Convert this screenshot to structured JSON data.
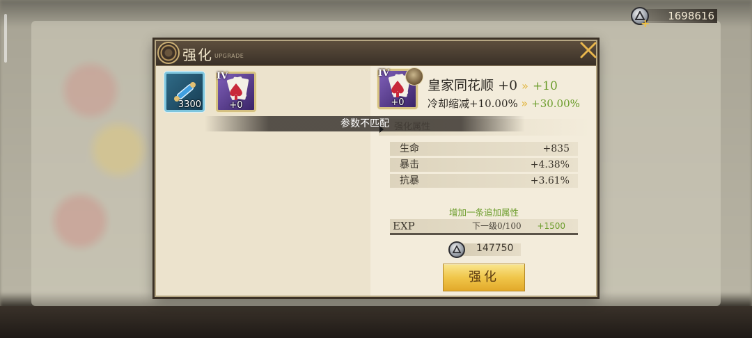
{
  "currency": {
    "value": "1698616",
    "icon": "silver-coin-icon"
  },
  "dialog": {
    "title": "强化",
    "subtitle": "UPGRADE"
  },
  "materials": [
    {
      "name": "scroll",
      "icon": "scroll-icon",
      "count": "3300"
    },
    {
      "name": "royal-flush-card",
      "icon": "spade-card-icon",
      "level": "IV",
      "plus": "+0"
    }
  ],
  "target": {
    "icon": "spade-card-icon",
    "level": "IV",
    "plus": "+0",
    "name": "皇家同花顺",
    "current_level": "+0",
    "next_level": "+10",
    "cooldown_label": "冷却缩减+10.00%",
    "cooldown_next": "+30.00%"
  },
  "banner": "参数不匹配",
  "attributes": {
    "heading": "强化属性",
    "rows": [
      {
        "key": "生命",
        "value": "+835"
      },
      {
        "key": "暴击",
        "value": "+4.38%"
      },
      {
        "key": "抗暴",
        "value": "+3.61%"
      }
    ]
  },
  "add_attr_text": "增加一条追加属性",
  "exp": {
    "label": "EXP",
    "next_level": "下一级0/100",
    "gain": "+1500",
    "progress": 0
  },
  "cost": {
    "value": "147750"
  },
  "upgrade_button": "强化",
  "colors": {
    "gold": "#f0c64a",
    "green": "#6a9c2a",
    "panel": "#f1ead8"
  }
}
